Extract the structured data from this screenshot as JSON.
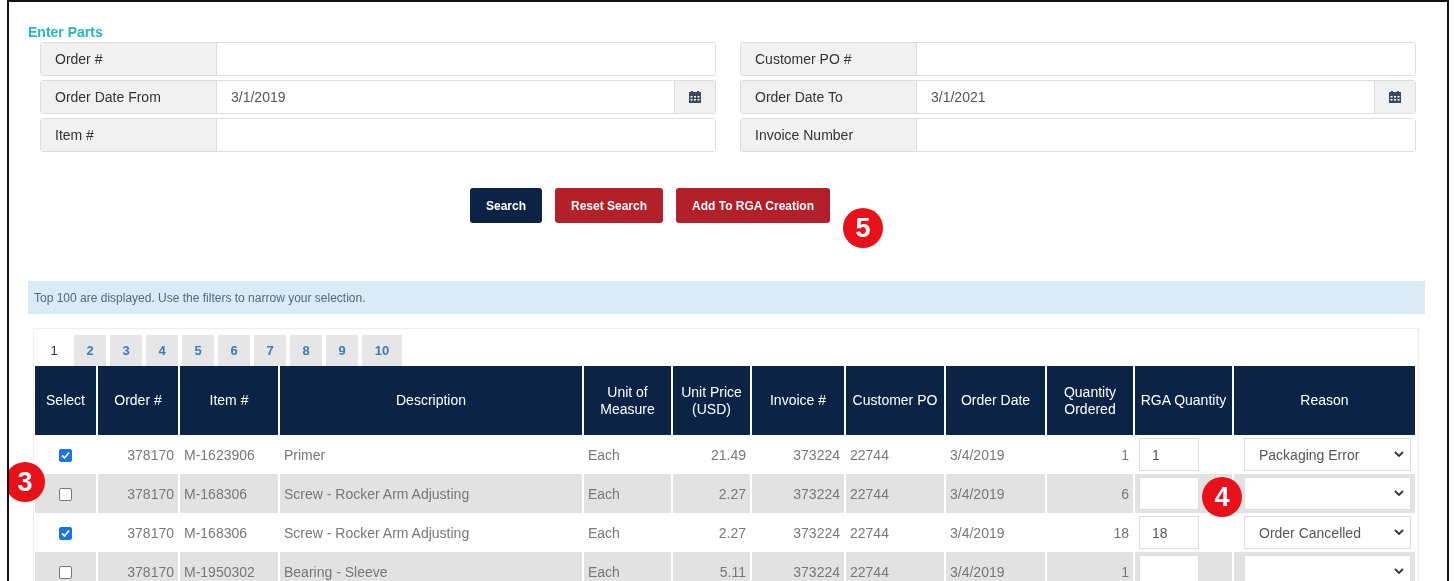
{
  "section_title": "Enter Parts",
  "fields": [
    {
      "label": "Order #",
      "kind": "text"
    },
    {
      "label": "Customer PO #",
      "kind": "text"
    },
    {
      "label": "Order Date From",
      "kind": "date",
      "value": "3/1/2019"
    },
    {
      "label": "Order Date To",
      "kind": "date",
      "value": "3/1/2021"
    },
    {
      "label": "Item #",
      "kind": "text"
    },
    {
      "label": "Invoice Number",
      "kind": "text"
    }
  ],
  "buttons": [
    {
      "label": "Search",
      "kind": "primary"
    },
    {
      "label": "Reset Search",
      "kind": "danger"
    },
    {
      "label": "Add To RGA Creation",
      "kind": "danger"
    }
  ],
  "annotations": [
    {
      "number": "5"
    },
    {
      "number": "3"
    },
    {
      "number": "4"
    }
  ],
  "info": "Top 100 are displayed. Use the filters to narrow your selection.",
  "pages": [
    {
      "label": "1",
      "selected": true
    },
    {
      "label": "2",
      "selected": false
    },
    {
      "label": "3",
      "selected": false
    },
    {
      "label": "4",
      "selected": false
    },
    {
      "label": "5",
      "selected": false
    },
    {
      "label": "6",
      "selected": false
    },
    {
      "label": "7",
      "selected": false
    },
    {
      "label": "8",
      "selected": false
    },
    {
      "label": "9",
      "selected": false
    },
    {
      "label": "10",
      "selected": false
    }
  ],
  "table": {
    "columns": [
      "Select",
      "Order #",
      "Item #",
      "Description",
      "Unit of Measure",
      "Unit Price (USD)",
      "Invoice #",
      "Customer PO",
      "Order Date",
      "Quantity Ordered",
      "RGA Quantity",
      "Reason"
    ],
    "rows": [
      {
        "selected": true,
        "order": "378170",
        "item": "M-1623906",
        "description": "Primer",
        "unit": "Each",
        "price": "21.49",
        "invoice": "373224",
        "po": "22744",
        "date": "3/4/2019",
        "qty": "1",
        "rga_qty": "1",
        "reason": "Packaging Error"
      },
      {
        "selected": false,
        "order": "378170",
        "item": "M-168306",
        "description": "Screw - Rocker Arm Adjusting",
        "unit": "Each",
        "price": "2.27",
        "invoice": "373224",
        "po": "22744",
        "date": "3/4/2019",
        "qty": "6"
      },
      {
        "selected": true,
        "order": "378170",
        "item": "M-168306",
        "description": "Screw - Rocker Arm Adjusting",
        "unit": "Each",
        "price": "2.27",
        "invoice": "373224",
        "po": "22744",
        "date": "3/4/2019",
        "qty": "18",
        "rga_qty": "18",
        "reason": "Order Cancelled"
      },
      {
        "selected": false,
        "order": "378170",
        "item": "M-1950302",
        "description": "Bearing - Sleeve",
        "unit": "Each",
        "price": "5.11",
        "invoice": "373224",
        "po": "22744",
        "date": "3/4/2019",
        "qty": "1"
      }
    ]
  }
}
